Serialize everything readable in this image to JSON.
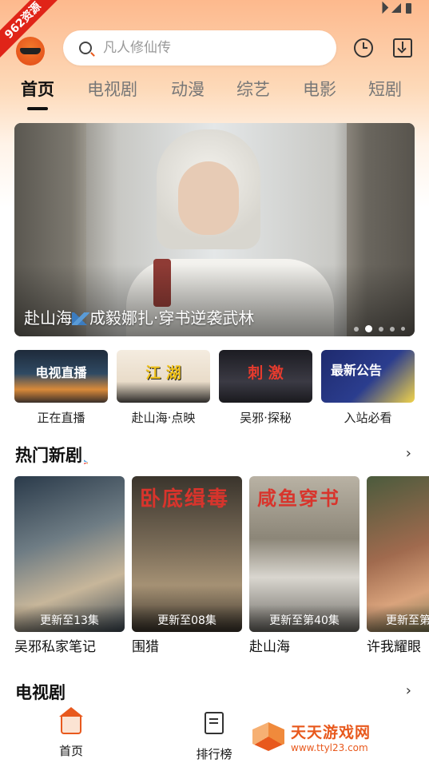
{
  "ribbon": "962资源",
  "search": {
    "placeholder": "凡人修仙传"
  },
  "tabs": [
    "首页",
    "电视剧",
    "动漫",
    "综艺",
    "电影",
    "短剧"
  ],
  "banner": {
    "title": "赴山海",
    "title_rest": "成毅娜扎·穿书逆袭武林"
  },
  "entries": [
    {
      "thumb": "电视直播",
      "label": "正在直播"
    },
    {
      "thumb": "江 湖",
      "label": "赴山海·点映"
    },
    {
      "thumb": "刺 激",
      "label": "吴邪·探秘"
    },
    {
      "thumb": "最新公告",
      "label": "入站必看"
    }
  ],
  "sections": {
    "hot": "热门新剧",
    "tv": "电视剧",
    "more": "›"
  },
  "cards": [
    {
      "update": "更新至13集",
      "title": "吴邪私家笔记"
    },
    {
      "update": "更新至08集",
      "title": "围猎",
      "poster_text": "卧底缉毒"
    },
    {
      "update": "更新至第40集",
      "title": "赴山海",
      "poster_text": "咸鱼穿书"
    },
    {
      "update": "更新至第",
      "title": "许我耀眼"
    }
  ],
  "nav": {
    "home": "首页",
    "rank": "排行榜"
  },
  "watermark": {
    "name": "天天游戏网",
    "url": "www.ttyl23.com"
  },
  "colors": {
    "accent": "#e8591d",
    "ribbon": "#e02418"
  }
}
